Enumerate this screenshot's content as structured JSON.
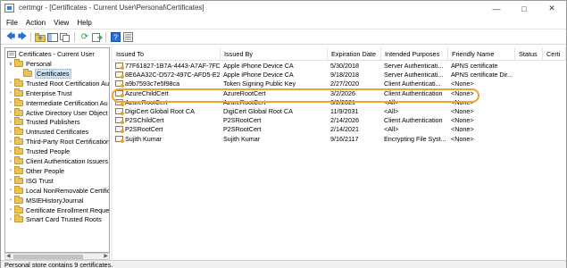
{
  "window": {
    "title": "certmgr - [Certificates - Current User\\Personal\\Certificates]",
    "min_icon": "minimize-icon",
    "max_icon": "maximize-icon",
    "close_icon": "close-icon"
  },
  "menu": [
    "File",
    "Action",
    "View",
    "Help"
  ],
  "toolbar": {
    "buttons": [
      "back-arrow-icon",
      "forward-arrow-icon",
      "up-folder-icon",
      "show-hide-tree-icon",
      "copy-icon",
      "refresh-icon",
      "export-list-icon",
      "help-icon",
      "properties-icon"
    ]
  },
  "tree": {
    "root": "Certificates - Current User",
    "items": [
      {
        "label": "Personal",
        "level": 1,
        "expanded": true
      },
      {
        "label": "Certificates",
        "level": 2,
        "selected": true
      },
      {
        "label": "Trusted Root Certification Au",
        "level": 1
      },
      {
        "label": "Enterprise Trust",
        "level": 1
      },
      {
        "label": "Intermediate Certification Au",
        "level": 1
      },
      {
        "label": "Active Directory User Object",
        "level": 1
      },
      {
        "label": "Trusted Publishers",
        "level": 1
      },
      {
        "label": "Untrusted Certificates",
        "level": 1
      },
      {
        "label": "Third-Party Root Certification",
        "level": 1
      },
      {
        "label": "Trusted People",
        "level": 1
      },
      {
        "label": "Client Authentication Issuers",
        "level": 1
      },
      {
        "label": "Other People",
        "level": 1
      },
      {
        "label": "ISG Trust",
        "level": 1
      },
      {
        "label": "Local NonRemovable Certific",
        "level": 1
      },
      {
        "label": "MSIEHistoryJournal",
        "level": 1
      },
      {
        "label": "Certificate Enrollment Reques",
        "level": 1
      },
      {
        "label": "Smart Card Trusted Roots",
        "level": 1
      }
    ]
  },
  "list": {
    "columns": [
      "Issued To",
      "Issued By",
      "Expiration Date",
      "Intended Purposes",
      "Friendly Name",
      "Status",
      "Certi"
    ],
    "rows": [
      [
        "77F61827-1B7A-4443-A7AF-7FD...",
        "Apple iPhone Device CA",
        "5/30/2018",
        "Server Authenticati...",
        "APNS certificate",
        "",
        ""
      ],
      [
        "8E6AA32C-D572-497C-AFD5-E2...",
        "Apple iPhone Device CA",
        "9/18/2018",
        "Server Authenticati...",
        "APNS certificate Dir...",
        "",
        ""
      ],
      [
        "a9b7593c7e5f98ca",
        "Token Signing Public Key",
        "2/27/2020",
        "Client Authenticati...",
        "<None>",
        "",
        ""
      ],
      [
        "AzureChildCert",
        "AzureRootCert",
        "3/2/2026",
        "Client Authentication",
        "<None>",
        "",
        ""
      ],
      [
        "AzureRootCert",
        "AzureRootCert",
        "3/2/2021",
        "<All>",
        "<None>",
        "",
        ""
      ],
      [
        "DigiCert Global Root CA",
        "DigiCert Global Root CA",
        "11/9/2031",
        "<All>",
        "<None>",
        "",
        ""
      ],
      [
        "P2SChildCert",
        "P2SRootCert",
        "2/14/2026",
        "Client Authentication",
        "<None>",
        "",
        ""
      ],
      [
        "P2SRootCert",
        "P2SRootCert",
        "2/14/2021",
        "<All>",
        "<None>",
        "",
        ""
      ],
      [
        "Sujith Kumar",
        "Sujith Kumar",
        "9/16/2117",
        "Encrypting File Syst...",
        "<None>",
        "",
        ""
      ]
    ],
    "highlighted_row": 3,
    "highlight_color": "#f0a431"
  },
  "status": {
    "text": "Personal store contains 9 certificates."
  }
}
